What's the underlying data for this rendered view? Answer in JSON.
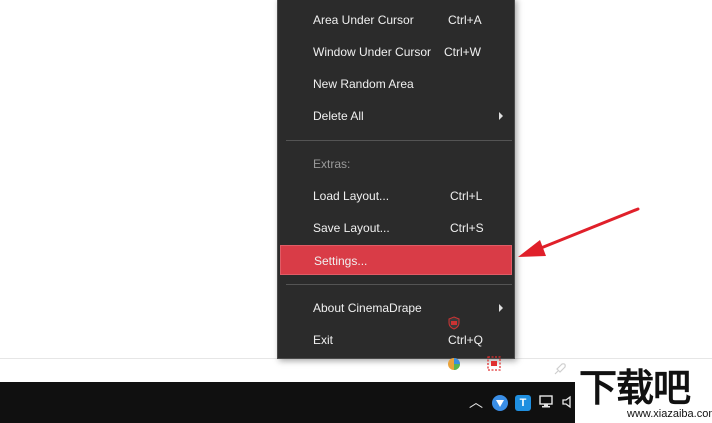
{
  "menu": {
    "items": [
      {
        "label": "Area Under Cursor",
        "shortcut": "Ctrl+A"
      },
      {
        "label": "Window Under Cursor",
        "shortcut": "Ctrl+W"
      },
      {
        "label": "New Random Area",
        "shortcut": ""
      },
      {
        "label": "Delete All",
        "shortcut": ""
      }
    ],
    "extras_header": "Extras:",
    "load_layout": {
      "label": "Load Layout...",
      "shortcut": "Ctrl+L"
    },
    "save_layout": {
      "label": "Save Layout...",
      "shortcut": "Ctrl+S"
    },
    "settings": {
      "label": "Settings..."
    },
    "about": {
      "label": "About CinemaDrape"
    },
    "exit": {
      "label": "Exit",
      "shortcut": "Ctrl+Q"
    },
    "highlight_color": "#d93c47"
  },
  "annotation": {
    "arrow_color": "#e0202a"
  },
  "taskbar": {
    "tray_t_label": "T"
  },
  "watermark": {
    "brand": "下载吧",
    "domain": "www.xiazaiba.com"
  }
}
